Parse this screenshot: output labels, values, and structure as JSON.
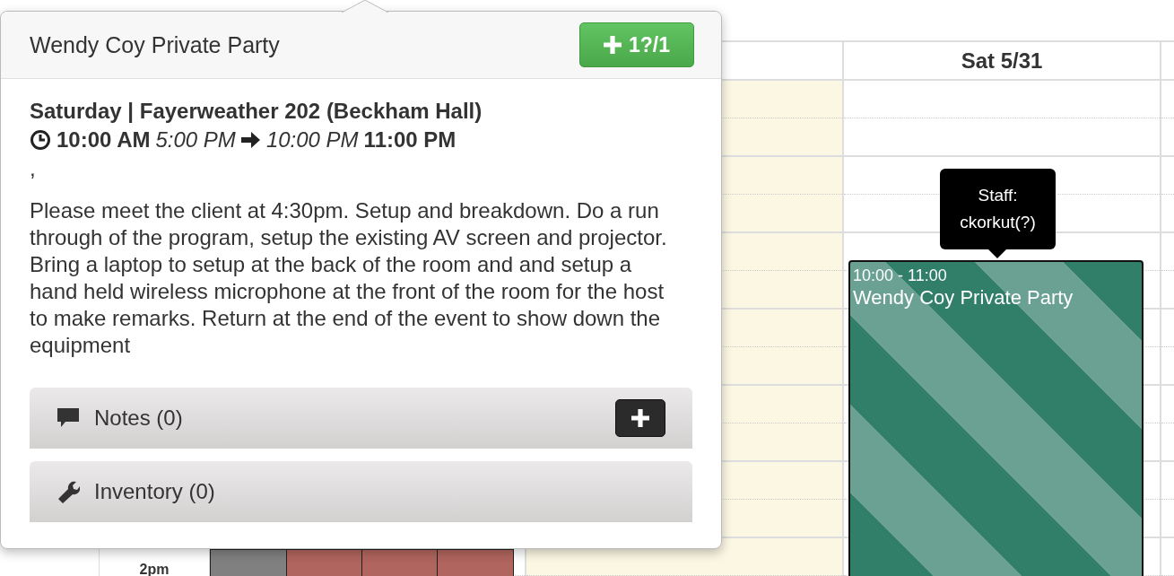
{
  "calendar": {
    "columns": [
      {
        "highlight": false
      },
      {
        "highlight": true
      },
      {
        "label": "Sat 5/31",
        "highlight": false
      },
      {
        "highlight": false
      }
    ],
    "time_labels": [
      "2pm"
    ],
    "blocks": [
      {
        "color": "#808080"
      },
      {
        "color": "#b0655e"
      },
      {
        "color": "#b0655e"
      },
      {
        "color": "#b0655e"
      }
    ],
    "event": {
      "time": "10:00 - 11:00",
      "title": "Wendy Coy Private Party"
    },
    "tooltip": {
      "lines": [
        "Staff:",
        "ckorkut(?)"
      ]
    }
  },
  "popover": {
    "title": "Wendy Coy Private Party",
    "count_button": "1?/1",
    "heading": "Saturday | Fayerweather 202 (Beckham Hall)",
    "times": {
      "start": "10:00 AM",
      "orig_start": "5:00 PM",
      "orig_end": "10:00 PM",
      "end": "11:00 PM"
    },
    "separator": ",",
    "description": "Please meet the client at 4:30pm. Setup and breakdown. Do a run through of the program, setup the existing AV screen and projector. Bring a laptop to setup at the back of the room and and setup a hand held wireless microphone at the front of the room for the host to make remarks. Return at the end of the event to show down the equipment",
    "sections": [
      {
        "kind": "notes",
        "label": "Notes (0)",
        "has_add": true
      },
      {
        "kind": "inventory",
        "label": "Inventory (0)",
        "has_add": false
      }
    ]
  }
}
